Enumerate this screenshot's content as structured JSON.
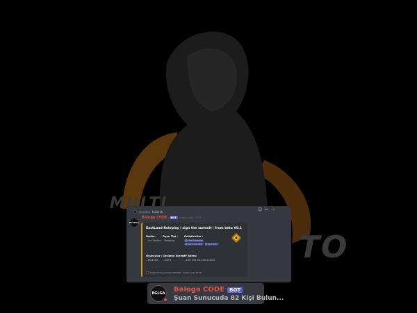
{
  "background": {
    "watermark_left": "MULTI",
    "watermark_right": "TO",
    "accent_color": "#d4800f"
  },
  "reply": {
    "user_command": "/sunucu",
    "suffix": "kullandı"
  },
  "message": {
    "avatar_text": "BALOGA",
    "author": "Baloga CODE",
    "bot_tag": "BOT",
    "time": "bugün saat 15:29",
    "toolbar_icons": [
      "add-reaction-icon",
      "reply-icon",
      "more-icon"
    ]
  },
  "embed": {
    "accent_color": "#d4a017",
    "title": "EastLand Roleplay | sign the summit | from beta V0.1",
    "fields": [
      {
        "name": "Harita :",
        "value": "- Los Santos"
      },
      {
        "name": "Oyun Tipi :",
        "value": "- Roleplay"
      },
      {
        "name": "Geliştiriciler :",
        "values": [
          "@charlimaddx",
          "@Commander",
          "@sortaver"
        ]
      },
      {
        "name": "Oyuncular :",
        "value": "- 85/4000"
      },
      {
        "name": "Gecikme Süresi :",
        "value": "- 44ms"
      },
      {
        "name": "IP Adres:",
        "value": "- 185.255.92.155:22003"
      }
    ],
    "footer": "Kullanıldı by echoapex#0499 • bugün saat 15:29"
  },
  "status_card": {
    "avatar_text": "BGLGA",
    "name": "Baloga CODE",
    "bot_tag": "BOT",
    "activity": "Şuan Sunucuda 82 Kişi Bulun..."
  }
}
